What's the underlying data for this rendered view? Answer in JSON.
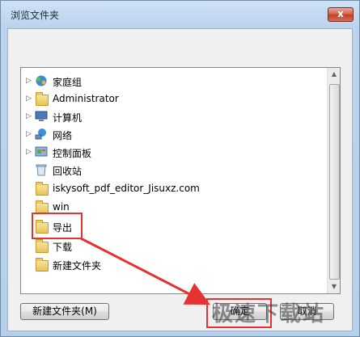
{
  "window": {
    "title": "浏览文件夹",
    "close_glyph": "x"
  },
  "tree": {
    "items": [
      {
        "label": "家庭组",
        "icon": "homegroup-icon",
        "has_arrow": true
      },
      {
        "label": "Administrator",
        "icon": "user-folder-icon",
        "has_arrow": true
      },
      {
        "label": "计算机",
        "icon": "computer-icon",
        "has_arrow": true
      },
      {
        "label": "网络",
        "icon": "network-icon",
        "has_arrow": true
      },
      {
        "label": "控制面板",
        "icon": "control-panel-icon",
        "has_arrow": true
      },
      {
        "label": "回收站",
        "icon": "recycle-bin-icon",
        "has_arrow": false
      },
      {
        "label": "iskysoft_pdf_editor_Jisuxz.com",
        "icon": "folder-icon",
        "has_arrow": false
      },
      {
        "label": "win",
        "icon": "folder-icon",
        "has_arrow": false
      },
      {
        "label": "导出",
        "icon": "folder-icon",
        "has_arrow": false,
        "selected": true
      },
      {
        "label": "下载",
        "icon": "folder-icon",
        "has_arrow": false
      },
      {
        "label": "新建文件夹",
        "icon": "folder-icon",
        "has_arrow": false
      }
    ]
  },
  "buttons": {
    "new_folder": "新建文件夹(M)",
    "ok": "确定",
    "cancel": "取消"
  },
  "watermark": "极速下载站",
  "colors": {
    "highlight_red": "#e53232"
  }
}
